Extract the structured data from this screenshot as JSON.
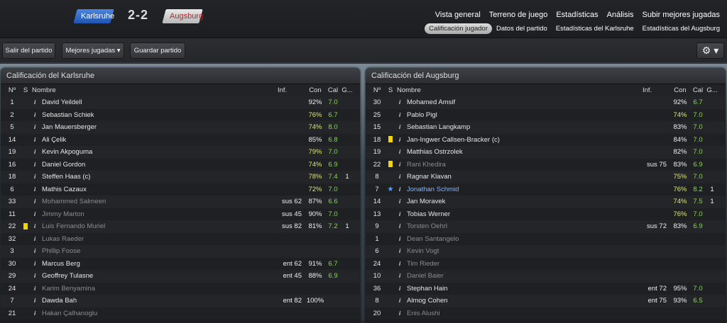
{
  "header": {
    "home_team": "Karlsruhe",
    "away_team": "Augsburg",
    "score": "2-2",
    "nav_primary": [
      "Vista general",
      "Terreno de juego",
      "Estadísticas",
      "Análisis",
      "Subir mejores jugadas"
    ],
    "nav_secondary": [
      "Calificación jugador",
      "Datos del partido",
      "Estadísticas del Karlsruhe",
      "Estadísticas del Augsburg"
    ],
    "active_secondary": "Calificación jugador"
  },
  "toolbar": {
    "exit_label": "Salir del partido",
    "highlights_label": "Mejores jugadas ▾",
    "save_label": "Guardar partido",
    "gear": "⚙ ▾"
  },
  "columns": {
    "no": "Nº",
    "s": "S",
    "name": "Nombre",
    "inf": "Inf.",
    "con": "Con",
    "cal": "Cal",
    "g": "G..."
  },
  "left": {
    "title": "Calificación del Karlsruhe",
    "rows": [
      {
        "no": "1",
        "s": "",
        "name": "David Yeildell",
        "inf": "",
        "con": "92%",
        "cal": "7.0",
        "g": "",
        "dim": false
      },
      {
        "no": "2",
        "s": "",
        "name": "Sebastian Schiek",
        "inf": "",
        "con": "76%",
        "cal": "6.7",
        "g": "",
        "dim": false
      },
      {
        "no": "5",
        "s": "",
        "name": "Jan Mauersberger",
        "inf": "",
        "con": "74%",
        "cal": "8.0",
        "g": "",
        "dim": false
      },
      {
        "no": "14",
        "s": "",
        "name": "Ali Çelik",
        "inf": "",
        "con": "85%",
        "cal": "6.8",
        "g": "",
        "dim": false
      },
      {
        "no": "19",
        "s": "",
        "name": "Kevin Akpoguma",
        "inf": "",
        "con": "79%",
        "cal": "7.0",
        "g": "",
        "dim": false
      },
      {
        "no": "16",
        "s": "",
        "name": "Daniel Gordon",
        "inf": "",
        "con": "74%",
        "cal": "6.9",
        "g": "",
        "dim": false
      },
      {
        "no": "18",
        "s": "",
        "name": "Steffen Haas (c)",
        "inf": "",
        "con": "78%",
        "cal": "7.4",
        "g": "1",
        "dim": false
      },
      {
        "no": "6",
        "s": "",
        "name": "Mathis Cazaux",
        "inf": "",
        "con": "72%",
        "cal": "7.0",
        "g": "",
        "dim": false
      },
      {
        "no": "33",
        "s": "",
        "name": "Mohammed Salmeen",
        "inf": "sus 62",
        "con": "87%",
        "cal": "6.6",
        "g": "",
        "dim": true
      },
      {
        "no": "11",
        "s": "",
        "name": "Jimmy Marton",
        "inf": "sus 45",
        "con": "90%",
        "cal": "7.0",
        "g": "",
        "dim": true
      },
      {
        "no": "22",
        "s": "yellow",
        "name": "Luis Fernando Muriel",
        "inf": "sus 82",
        "con": "81%",
        "cal": "7.2",
        "g": "1",
        "dim": true
      },
      {
        "no": "32",
        "s": "",
        "name": "Lukas Raeder",
        "inf": "",
        "con": "",
        "cal": "",
        "g": "",
        "dim": true
      },
      {
        "no": "3",
        "s": "",
        "name": "Phillip Foose",
        "inf": "",
        "con": "",
        "cal": "",
        "g": "",
        "dim": true
      },
      {
        "no": "30",
        "s": "",
        "name": "Marcus Berg",
        "inf": "ent 62",
        "con": "91%",
        "cal": "6.7",
        "g": "",
        "dim": false
      },
      {
        "no": "29",
        "s": "",
        "name": "Geoffrey Tulasne",
        "inf": "ent 45",
        "con": "88%",
        "cal": "6.9",
        "g": "",
        "dim": false
      },
      {
        "no": "24",
        "s": "",
        "name": "Karim Benyamina",
        "inf": "",
        "con": "",
        "cal": "",
        "g": "",
        "dim": true
      },
      {
        "no": "7",
        "s": "",
        "name": "Dawda Bah",
        "inf": "ent 82",
        "con": "100%",
        "cal": "",
        "g": "",
        "dim": false
      },
      {
        "no": "21",
        "s": "",
        "name": "Hakan Çalhanoglu",
        "inf": "",
        "con": "",
        "cal": "",
        "g": "",
        "dim": true
      }
    ]
  },
  "right": {
    "title": "Calificación del Augsburg",
    "rows": [
      {
        "no": "30",
        "s": "",
        "name": "Mohamed Amsif",
        "inf": "",
        "con": "92%",
        "cal": "6.7",
        "g": "",
        "dim": false
      },
      {
        "no": "25",
        "s": "",
        "name": "Pablo Pigl",
        "inf": "",
        "con": "74%",
        "cal": "7.0",
        "g": "",
        "dim": false
      },
      {
        "no": "15",
        "s": "",
        "name": "Sebastian Langkamp",
        "inf": "",
        "con": "83%",
        "cal": "7.0",
        "g": "",
        "dim": false
      },
      {
        "no": "18",
        "s": "yellow",
        "name": "Jan-Ingwer Callsen-Bracker (c)",
        "inf": "",
        "con": "84%",
        "cal": "7.0",
        "g": "",
        "dim": false
      },
      {
        "no": "19",
        "s": "",
        "name": "Matthias Ostrzolek",
        "inf": "",
        "con": "82%",
        "cal": "7.0",
        "g": "",
        "dim": false
      },
      {
        "no": "22",
        "s": "yellow",
        "name": "Rani Khedira",
        "inf": "sus 75",
        "con": "83%",
        "cal": "6.9",
        "g": "",
        "dim": true
      },
      {
        "no": "8",
        "s": "",
        "name": "Ragnar Klavan",
        "inf": "",
        "con": "75%",
        "cal": "7.0",
        "g": "",
        "dim": false
      },
      {
        "no": "7",
        "s": "star",
        "name": "Jonathan Schmid",
        "inf": "",
        "con": "76%",
        "cal": "8.2",
        "g": "1",
        "dim": false,
        "blue": true
      },
      {
        "no": "14",
        "s": "",
        "name": "Jan Moravek",
        "inf": "",
        "con": "74%",
        "cal": "7.5",
        "g": "1",
        "dim": false
      },
      {
        "no": "13",
        "s": "",
        "name": "Tobias Werner",
        "inf": "",
        "con": "76%",
        "cal": "7.0",
        "g": "",
        "dim": false
      },
      {
        "no": "9",
        "s": "",
        "name": "Torsten Oehrl",
        "inf": "sus 72",
        "con": "83%",
        "cal": "6.9",
        "g": "",
        "dim": true
      },
      {
        "no": "1",
        "s": "",
        "name": "Dean Santangelo",
        "inf": "",
        "con": "",
        "cal": "",
        "g": "",
        "dim": true
      },
      {
        "no": "6",
        "s": "",
        "name": "Kevin Vogt",
        "inf": "",
        "con": "",
        "cal": "",
        "g": "",
        "dim": true
      },
      {
        "no": "24",
        "s": "",
        "name": "Tim Rieder",
        "inf": "",
        "con": "",
        "cal": "",
        "g": "",
        "dim": true
      },
      {
        "no": "10",
        "s": "",
        "name": "Daniel Baier",
        "inf": "",
        "con": "",
        "cal": "",
        "g": "",
        "dim": true
      },
      {
        "no": "36",
        "s": "",
        "name": "Stephan Hain",
        "inf": "ent 72",
        "con": "95%",
        "cal": "7.0",
        "g": "",
        "dim": false
      },
      {
        "no": "8",
        "s": "",
        "name": "Almog Cohen",
        "inf": "ent 75",
        "con": "93%",
        "cal": "6.5",
        "g": "",
        "dim": false
      },
      {
        "no": "20",
        "s": "",
        "name": "Enis Alushi",
        "inf": "",
        "con": "",
        "cal": "",
        "g": "",
        "dim": true
      }
    ]
  }
}
